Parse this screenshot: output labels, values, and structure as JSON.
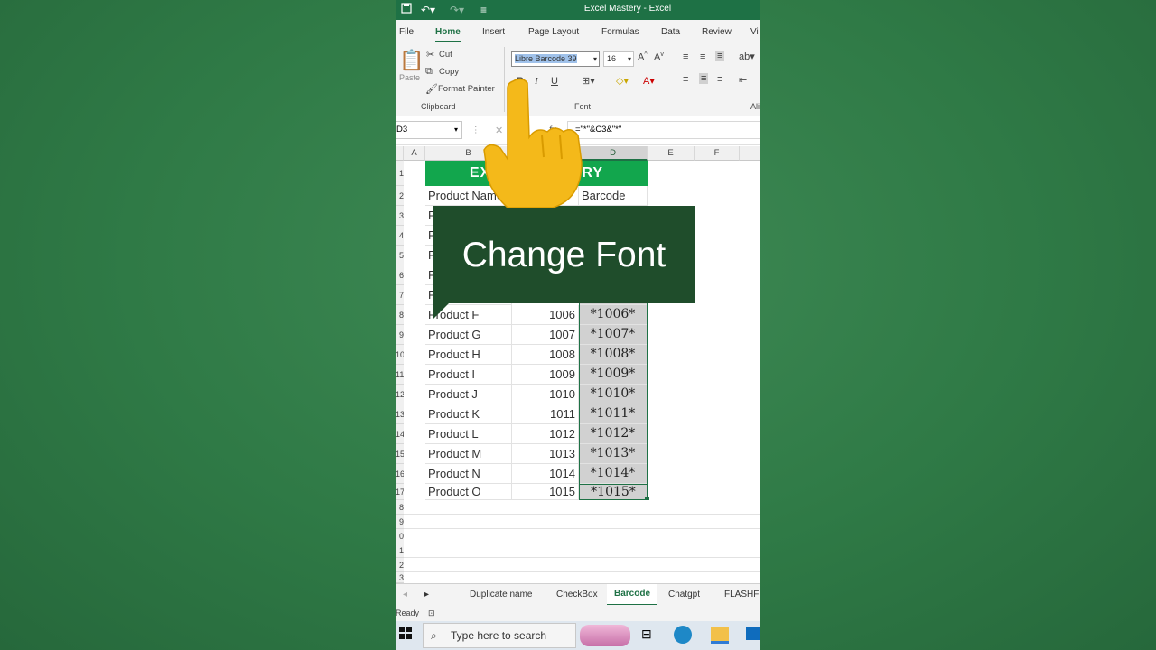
{
  "window": {
    "title": "Excel Mastery  -  Excel"
  },
  "ribbon_tabs": [
    "File",
    "Home",
    "Insert",
    "Page Layout",
    "Formulas",
    "Data",
    "Review",
    "Vi"
  ],
  "clipboard": {
    "paste": "Paste",
    "cut": "Cut",
    "copy": "Copy",
    "format_painter": "Format Painter",
    "group_label": "Clipboard"
  },
  "font": {
    "name": "Libre Barcode 39",
    "size": "16",
    "group_label": "Font",
    "bold": "B",
    "italic": "I",
    "underline": "U"
  },
  "alignment": {
    "group_label": "Ali"
  },
  "formula_bar": {
    "name_box": "D3",
    "formula": "=\"*\"&C3&\"*\"",
    "fx": "fx"
  },
  "columns": [
    "A",
    "B",
    "C",
    "D",
    "E",
    "F"
  ],
  "banner": "EXCEL MASTERY",
  "header_row": {
    "b": "Product Name",
    "d": "Barcode"
  },
  "rows": [
    {
      "row": "8",
      "name": "Product F",
      "code": "1006",
      "barcode": "*1006*"
    },
    {
      "row": "9",
      "name": "Product G",
      "code": "1007",
      "barcode": "*1007*"
    },
    {
      "row": "10",
      "name": "Product H",
      "code": "1008",
      "barcode": "*1008*"
    },
    {
      "row": "11",
      "name": "Product I",
      "code": "1009",
      "barcode": "*1009*"
    },
    {
      "row": "12",
      "name": "Product J",
      "code": "1010",
      "barcode": "*1010*"
    },
    {
      "row": "13",
      "name": "Product K",
      "code": "1011",
      "barcode": "*1011*"
    },
    {
      "row": "14",
      "name": "Product L",
      "code": "1012",
      "barcode": "*1012*"
    },
    {
      "row": "15",
      "name": "Product M",
      "code": "1013",
      "barcode": "*1013*"
    },
    {
      "row": "16",
      "name": "Product N",
      "code": "1014",
      "barcode": "*1014*"
    },
    {
      "row": "17",
      "name": "Product O",
      "code": "1015",
      "barcode": "*1015*"
    }
  ],
  "sheet_tabs": [
    "Duplicate name",
    "CheckBox",
    "Barcode",
    "Chatgpt",
    "FLASHFIL"
  ],
  "active_sheet": "Barcode",
  "status": "Ready",
  "taskbar": {
    "search_placeholder": "Type here to search"
  },
  "overlay": {
    "callout": "Change Font"
  }
}
